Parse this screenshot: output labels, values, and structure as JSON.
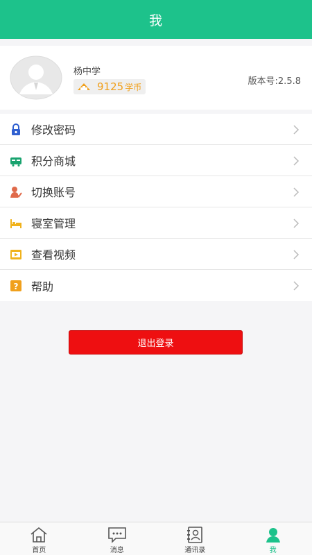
{
  "header": {
    "title": "我"
  },
  "profile": {
    "name": "杨中学",
    "coins_value": "9125",
    "coins_unit": "学币",
    "version": "版本号:2.5.8"
  },
  "menu": [
    {
      "label": "修改密码",
      "icon": "lock-icon"
    },
    {
      "label": "积分商城",
      "icon": "store-icon"
    },
    {
      "label": "切换账号",
      "icon": "switch-account-icon"
    },
    {
      "label": "寝室管理",
      "icon": "bed-icon"
    },
    {
      "label": "查看视频",
      "icon": "video-icon"
    },
    {
      "label": "帮助",
      "icon": "help-icon"
    }
  ],
  "logout_label": "退出登录",
  "tabs": [
    {
      "label": "首页",
      "icon": "home-icon"
    },
    {
      "label": "消息",
      "icon": "message-icon"
    },
    {
      "label": "通讯录",
      "icon": "contacts-icon"
    },
    {
      "label": "我",
      "icon": "person-icon",
      "active": true
    }
  ],
  "colors": {
    "brand": "#1dc28b",
    "logout": "#ee0f11",
    "coin": "#f0a01c"
  }
}
